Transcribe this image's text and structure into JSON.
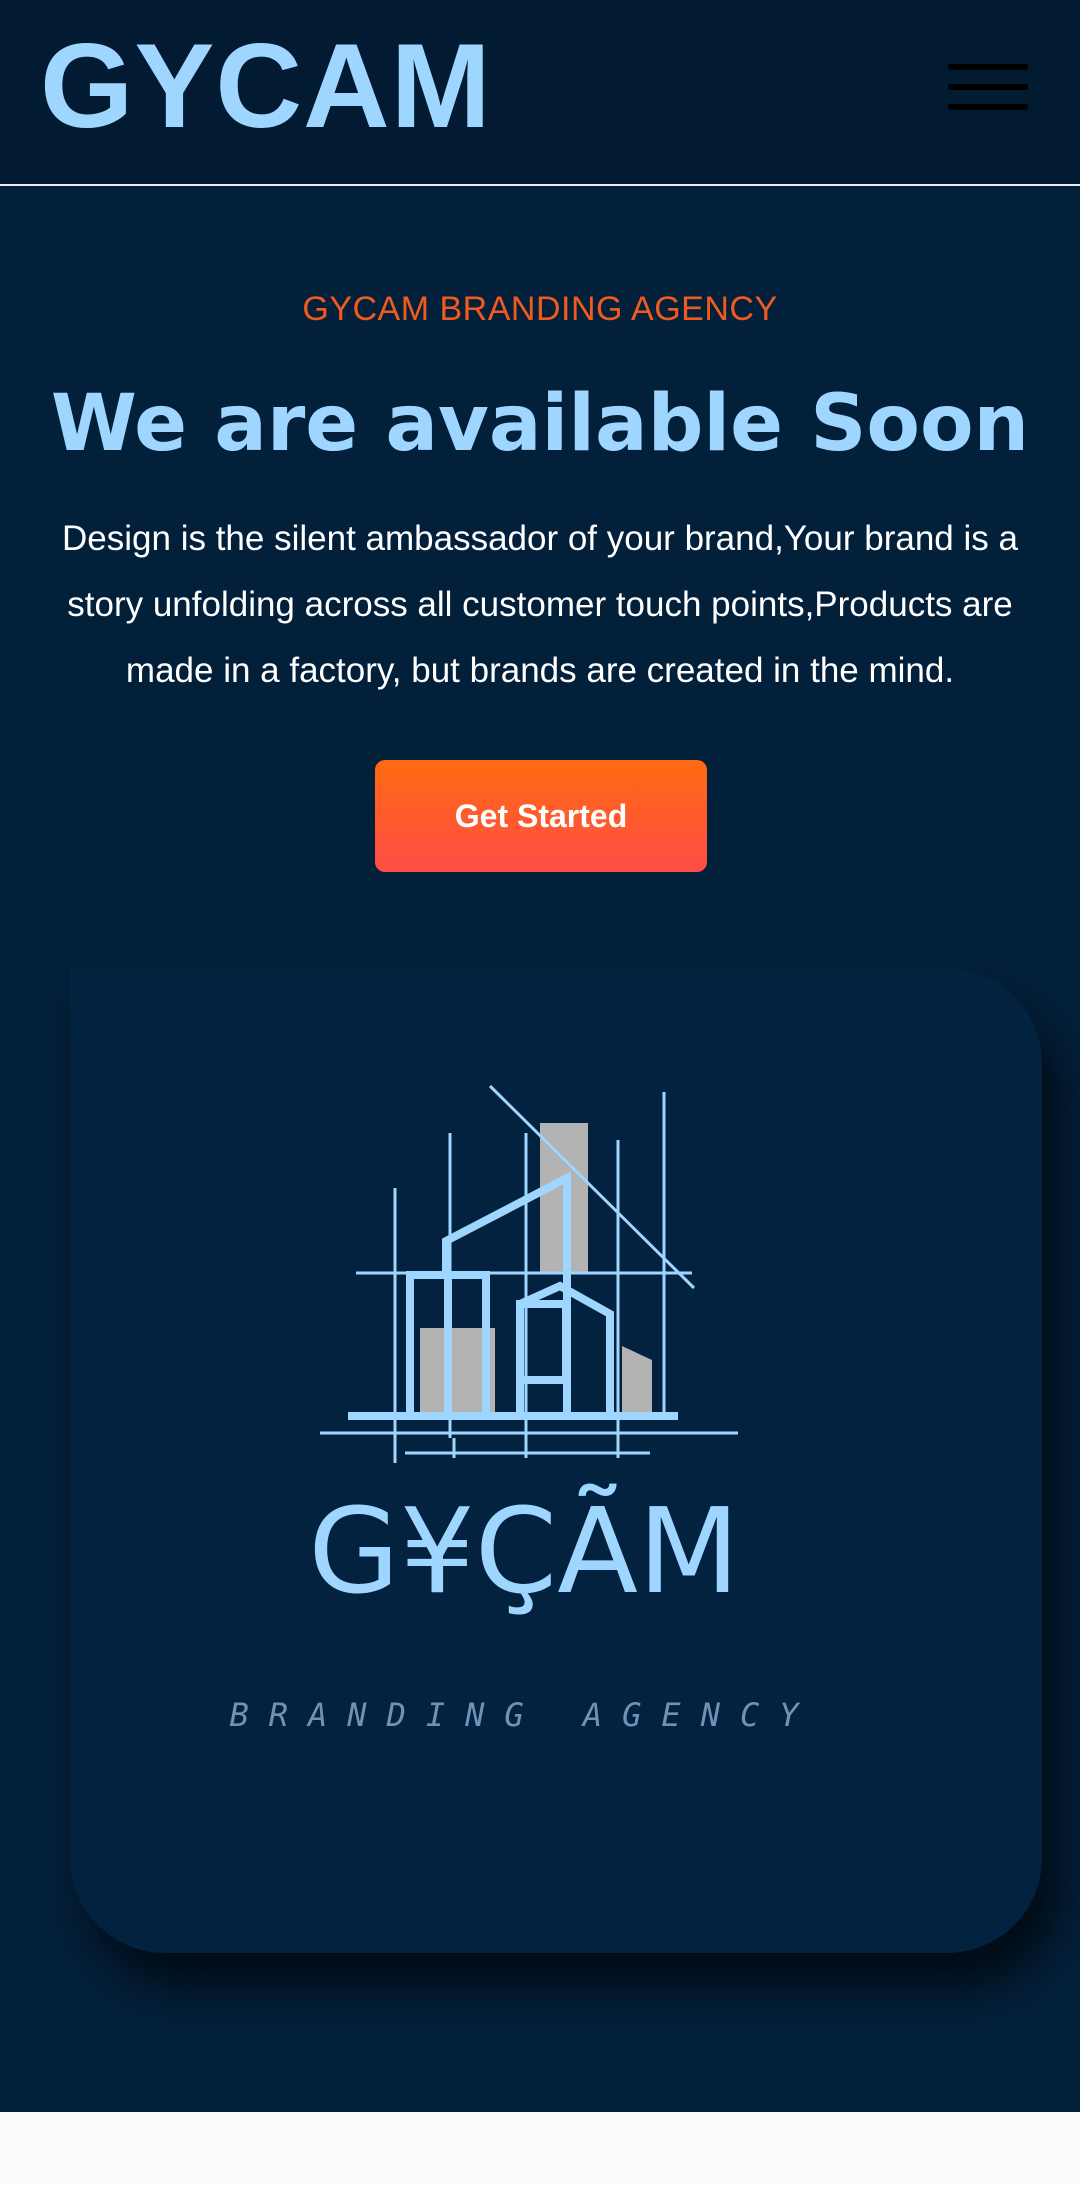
{
  "header": {
    "brand": "GYCAM",
    "menu_icon": "hamburger-menu-icon"
  },
  "hero": {
    "eyebrow": "GYCAM BRANDING AGENCY",
    "headline": "We are available Soon",
    "description": "Design is the silent ambassador of your brand,Your brand is a story unfolding across all customer touch points,Products are made in a factory, but brands are created in the mind.",
    "cta_label": "Get Started"
  },
  "logo": {
    "icon": "building-sketch-logo-icon",
    "wordmark": "G¥ÇÃM",
    "tagline": "BRANDING AGENCY"
  },
  "colors": {
    "background": "#03203b",
    "header_bg": "#021a32",
    "brand_blue": "#9fd6ff",
    "accent_orange": "#f05a1e",
    "cta_top": "#ff6a10",
    "cta_bottom": "#ff4d48"
  }
}
